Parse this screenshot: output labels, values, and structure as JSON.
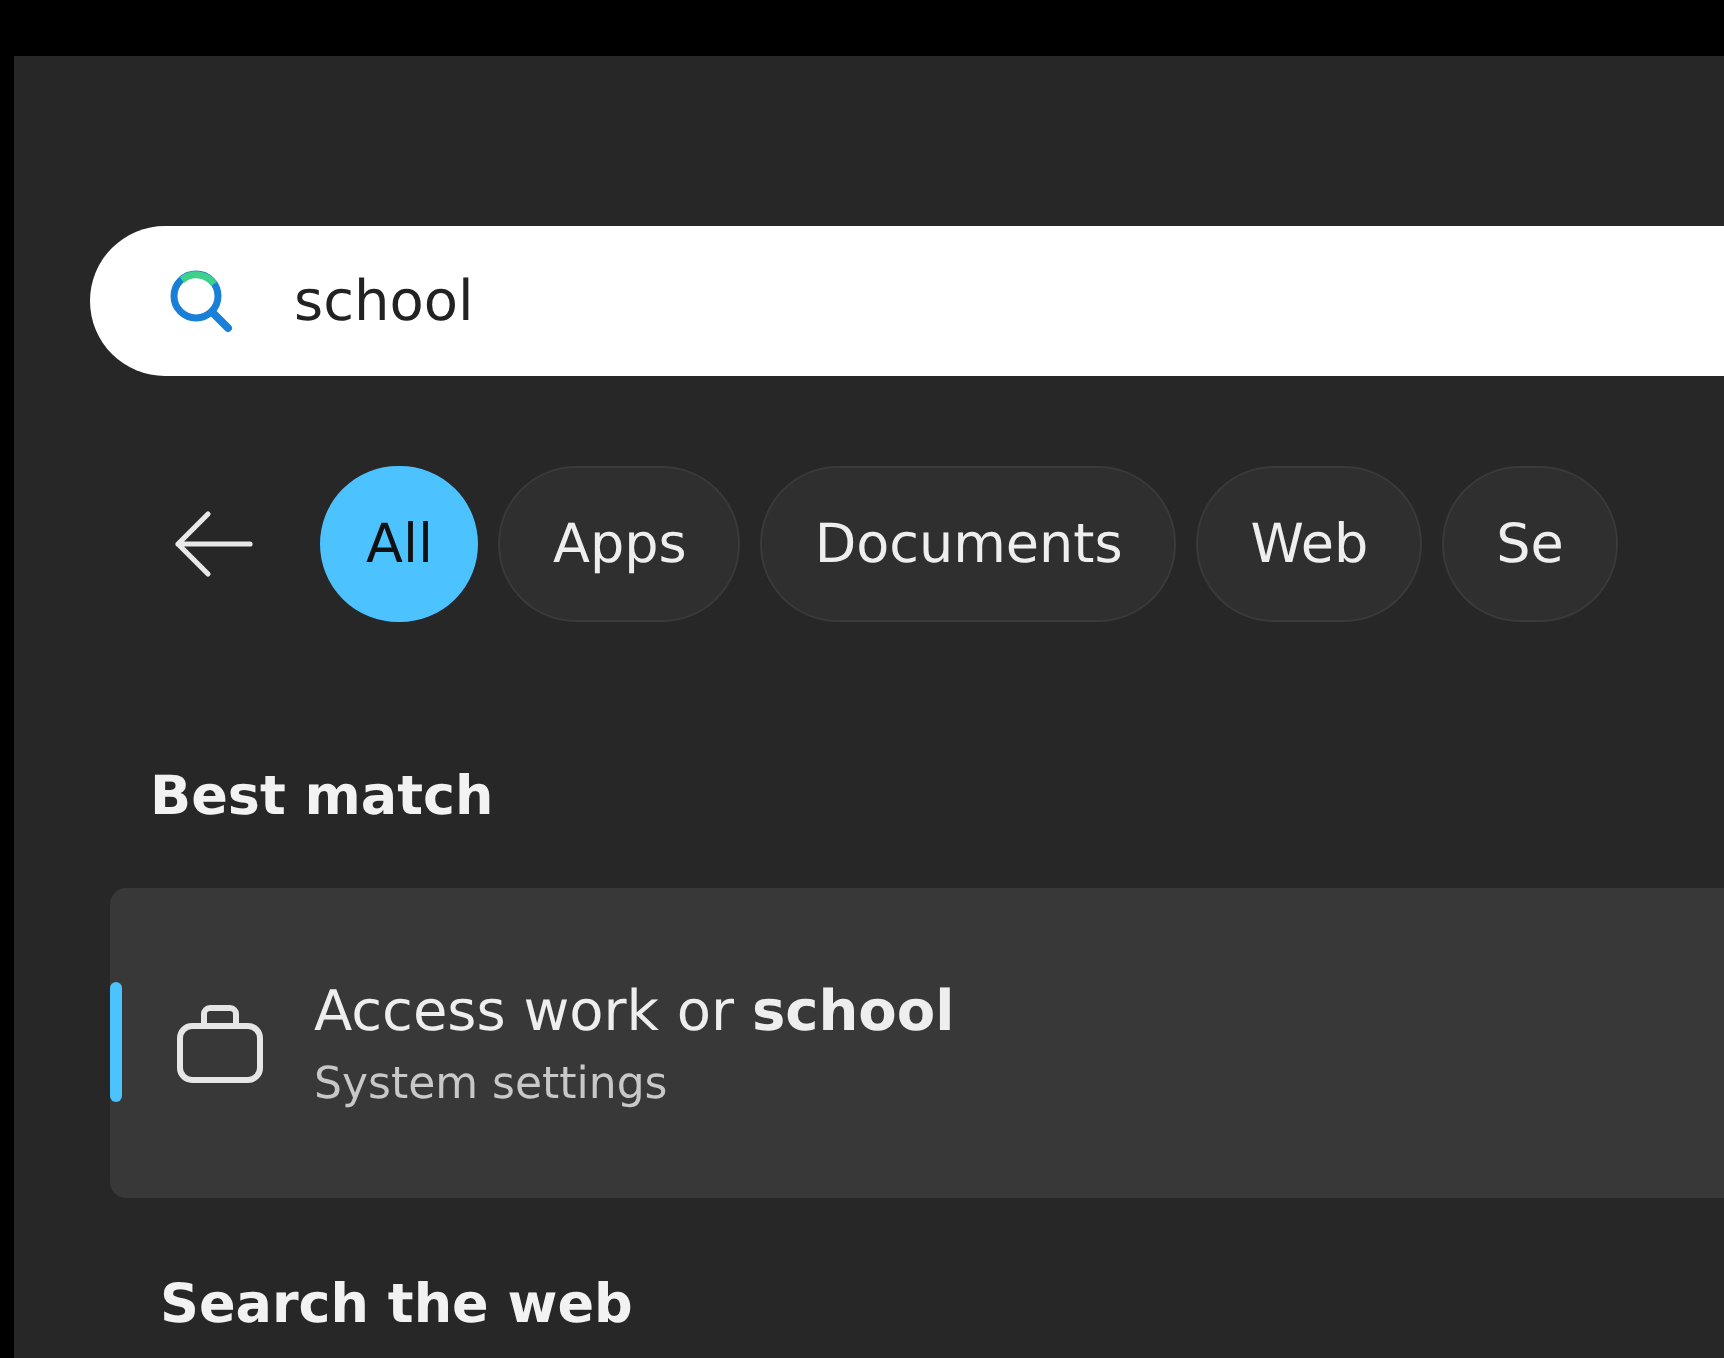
{
  "search": {
    "value": "school"
  },
  "filters": [
    {
      "label": "All",
      "selected": true
    },
    {
      "label": "Apps",
      "selected": false
    },
    {
      "label": "Documents",
      "selected": false
    },
    {
      "label": "Web",
      "selected": false
    },
    {
      "label": "Se",
      "selected": false
    }
  ],
  "best_match": {
    "heading": "Best match",
    "result": {
      "title": "Access work or **school**",
      "subtitle": "System settings",
      "selected": true
    }
  },
  "search_the_web": {
    "heading": "Search the web"
  }
}
